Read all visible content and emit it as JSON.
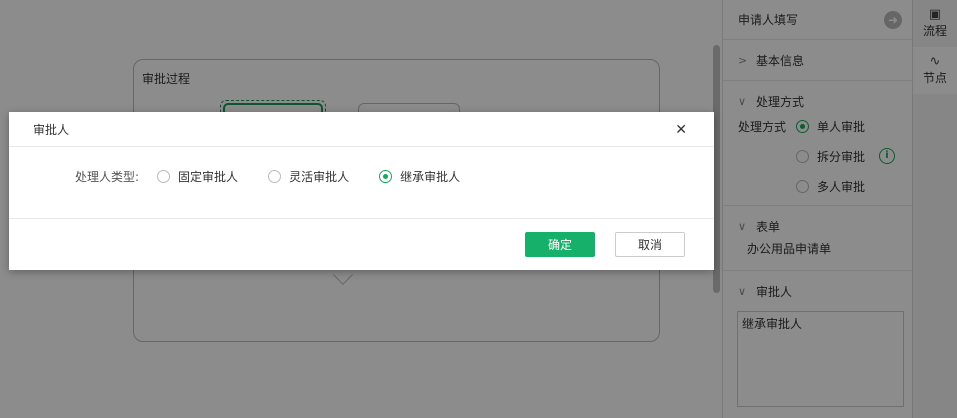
{
  "canvas": {
    "process_title": "审批过程"
  },
  "panel": {
    "header": "申请人填写",
    "sections": {
      "basic_info": "基本信息",
      "handling": {
        "title": "处理方式",
        "label": "处理方式",
        "options": [
          "单人审批",
          "拆分审批",
          "多人审批"
        ],
        "selected": "单人审批"
      },
      "form": {
        "title": "表单",
        "value": "办公用品申请单"
      },
      "approver": {
        "title": "审批人",
        "value": "继承审批人"
      }
    }
  },
  "tabs": [
    {
      "label": "流程",
      "icon": "flow-icon"
    },
    {
      "label": "节点",
      "icon": "node-icon"
    }
  ],
  "dialog": {
    "title": "审批人",
    "type_label": "处理人类型:",
    "options": [
      "固定审批人",
      "灵活审批人",
      "继承审批人"
    ],
    "selected": "继承审批人",
    "ok_label": "确定",
    "cancel_label": "取消"
  },
  "colors": {
    "accent": "#17b06a",
    "overlay": "rgba(0,0,0,0.45)"
  }
}
